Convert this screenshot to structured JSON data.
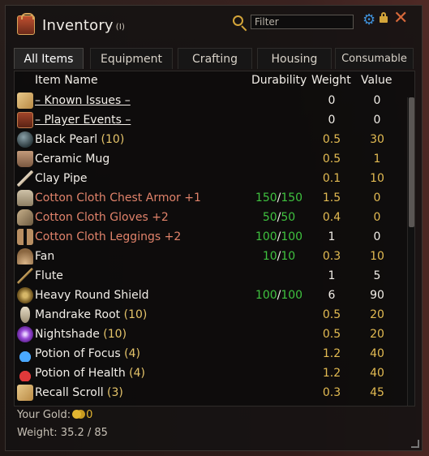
{
  "window": {
    "title": "Inventory",
    "hotkey": "(I)",
    "filter_placeholder": "Filter"
  },
  "tabs": [
    {
      "label": "All Items",
      "active": true
    },
    {
      "label": "Equipment",
      "active": false
    },
    {
      "label": "Crafting",
      "active": false
    },
    {
      "label": "Housing",
      "active": false
    },
    {
      "label": "Consumable",
      "active": false
    }
  ],
  "columns": {
    "name": "Item Name",
    "durability": "Durability",
    "weight": "Weight",
    "value": "Value"
  },
  "items": [
    {
      "name": "– Known Issues –",
      "qty": "",
      "dur_cur": "",
      "dur_max": "",
      "weight": "0",
      "value": "0",
      "icon": "scroll-icon",
      "kind": "category"
    },
    {
      "name": "– Player Events –",
      "qty": "",
      "dur_cur": "",
      "dur_max": "",
      "weight": "0",
      "value": "0",
      "icon": "book-icon",
      "kind": "category"
    },
    {
      "name": "Black Pearl",
      "qty": " (10)",
      "dur_cur": "",
      "dur_max": "",
      "weight": "0.5",
      "value": "30",
      "icon": "pearl-icon",
      "kind": "stack"
    },
    {
      "name": "Ceramic Mug",
      "qty": "",
      "dur_cur": "",
      "dur_max": "",
      "weight": "0.5",
      "value": "1",
      "icon": "mug-icon",
      "kind": "normal"
    },
    {
      "name": "Clay Pipe",
      "qty": "",
      "dur_cur": "",
      "dur_max": "",
      "weight": "0.1",
      "value": "10",
      "icon": "pipe-icon",
      "kind": "normal"
    },
    {
      "name": "Cotton Cloth Chest Armor +1",
      "qty": "",
      "dur_cur": "150",
      "dur_max": "150",
      "weight": "1.5",
      "value": "0",
      "icon": "chest-armor-icon",
      "kind": "equip"
    },
    {
      "name": "Cotton Cloth Gloves +2",
      "qty": "",
      "dur_cur": "50",
      "dur_max": "50",
      "weight": "0.4",
      "value": "0",
      "icon": "gloves-icon",
      "kind": "equip"
    },
    {
      "name": "Cotton Cloth Leggings +2",
      "qty": "",
      "dur_cur": "100",
      "dur_max": "100",
      "weight": "1",
      "value": "0",
      "icon": "leggings-icon",
      "kind": "equip"
    },
    {
      "name": "Fan",
      "qty": "",
      "dur_cur": "10",
      "dur_max": "10",
      "weight": "0.3",
      "value": "10",
      "icon": "fan-icon",
      "kind": "normal"
    },
    {
      "name": "Flute",
      "qty": "",
      "dur_cur": "",
      "dur_max": "",
      "weight": "1",
      "value": "5",
      "icon": "flute-icon",
      "kind": "normal"
    },
    {
      "name": "Heavy Round Shield",
      "qty": "",
      "dur_cur": "100",
      "dur_max": "100",
      "weight": "6",
      "value": "90",
      "icon": "shield-icon",
      "kind": "normal"
    },
    {
      "name": "Mandrake Root",
      "qty": " (10)",
      "dur_cur": "",
      "dur_max": "",
      "weight": "0.5",
      "value": "20",
      "icon": "root-icon",
      "kind": "stack"
    },
    {
      "name": "Nightshade",
      "qty": " (10)",
      "dur_cur": "",
      "dur_max": "",
      "weight": "0.5",
      "value": "20",
      "icon": "flower-icon",
      "kind": "stack"
    },
    {
      "name": "Potion of Focus",
      "qty": " (4)",
      "dur_cur": "",
      "dur_max": "",
      "weight": "1.2",
      "value": "40",
      "icon": "blue-potion-icon",
      "kind": "stack"
    },
    {
      "name": "Potion of Health",
      "qty": " (4)",
      "dur_cur": "",
      "dur_max": "",
      "weight": "1.2",
      "value": "40",
      "icon": "red-potion-icon",
      "kind": "stack"
    },
    {
      "name": "Recall Scroll",
      "qty": " (3)",
      "dur_cur": "",
      "dur_max": "",
      "weight": "0.3",
      "value": "45",
      "icon": "scroll-icon",
      "kind": "stack"
    }
  ],
  "footer": {
    "gold_label": "Your Gold:",
    "gold_value": "0",
    "weight_text": "Weight: 35.2 / 85"
  },
  "colors": {
    "accent_gold": "#e3bb52",
    "durability_green": "#3fc23f",
    "equip_red": "#e0826a",
    "close_orange": "#d6683a",
    "gear_blue": "#3f8fd6"
  },
  "scroll": {
    "thumb_fraction": 0.42
  }
}
